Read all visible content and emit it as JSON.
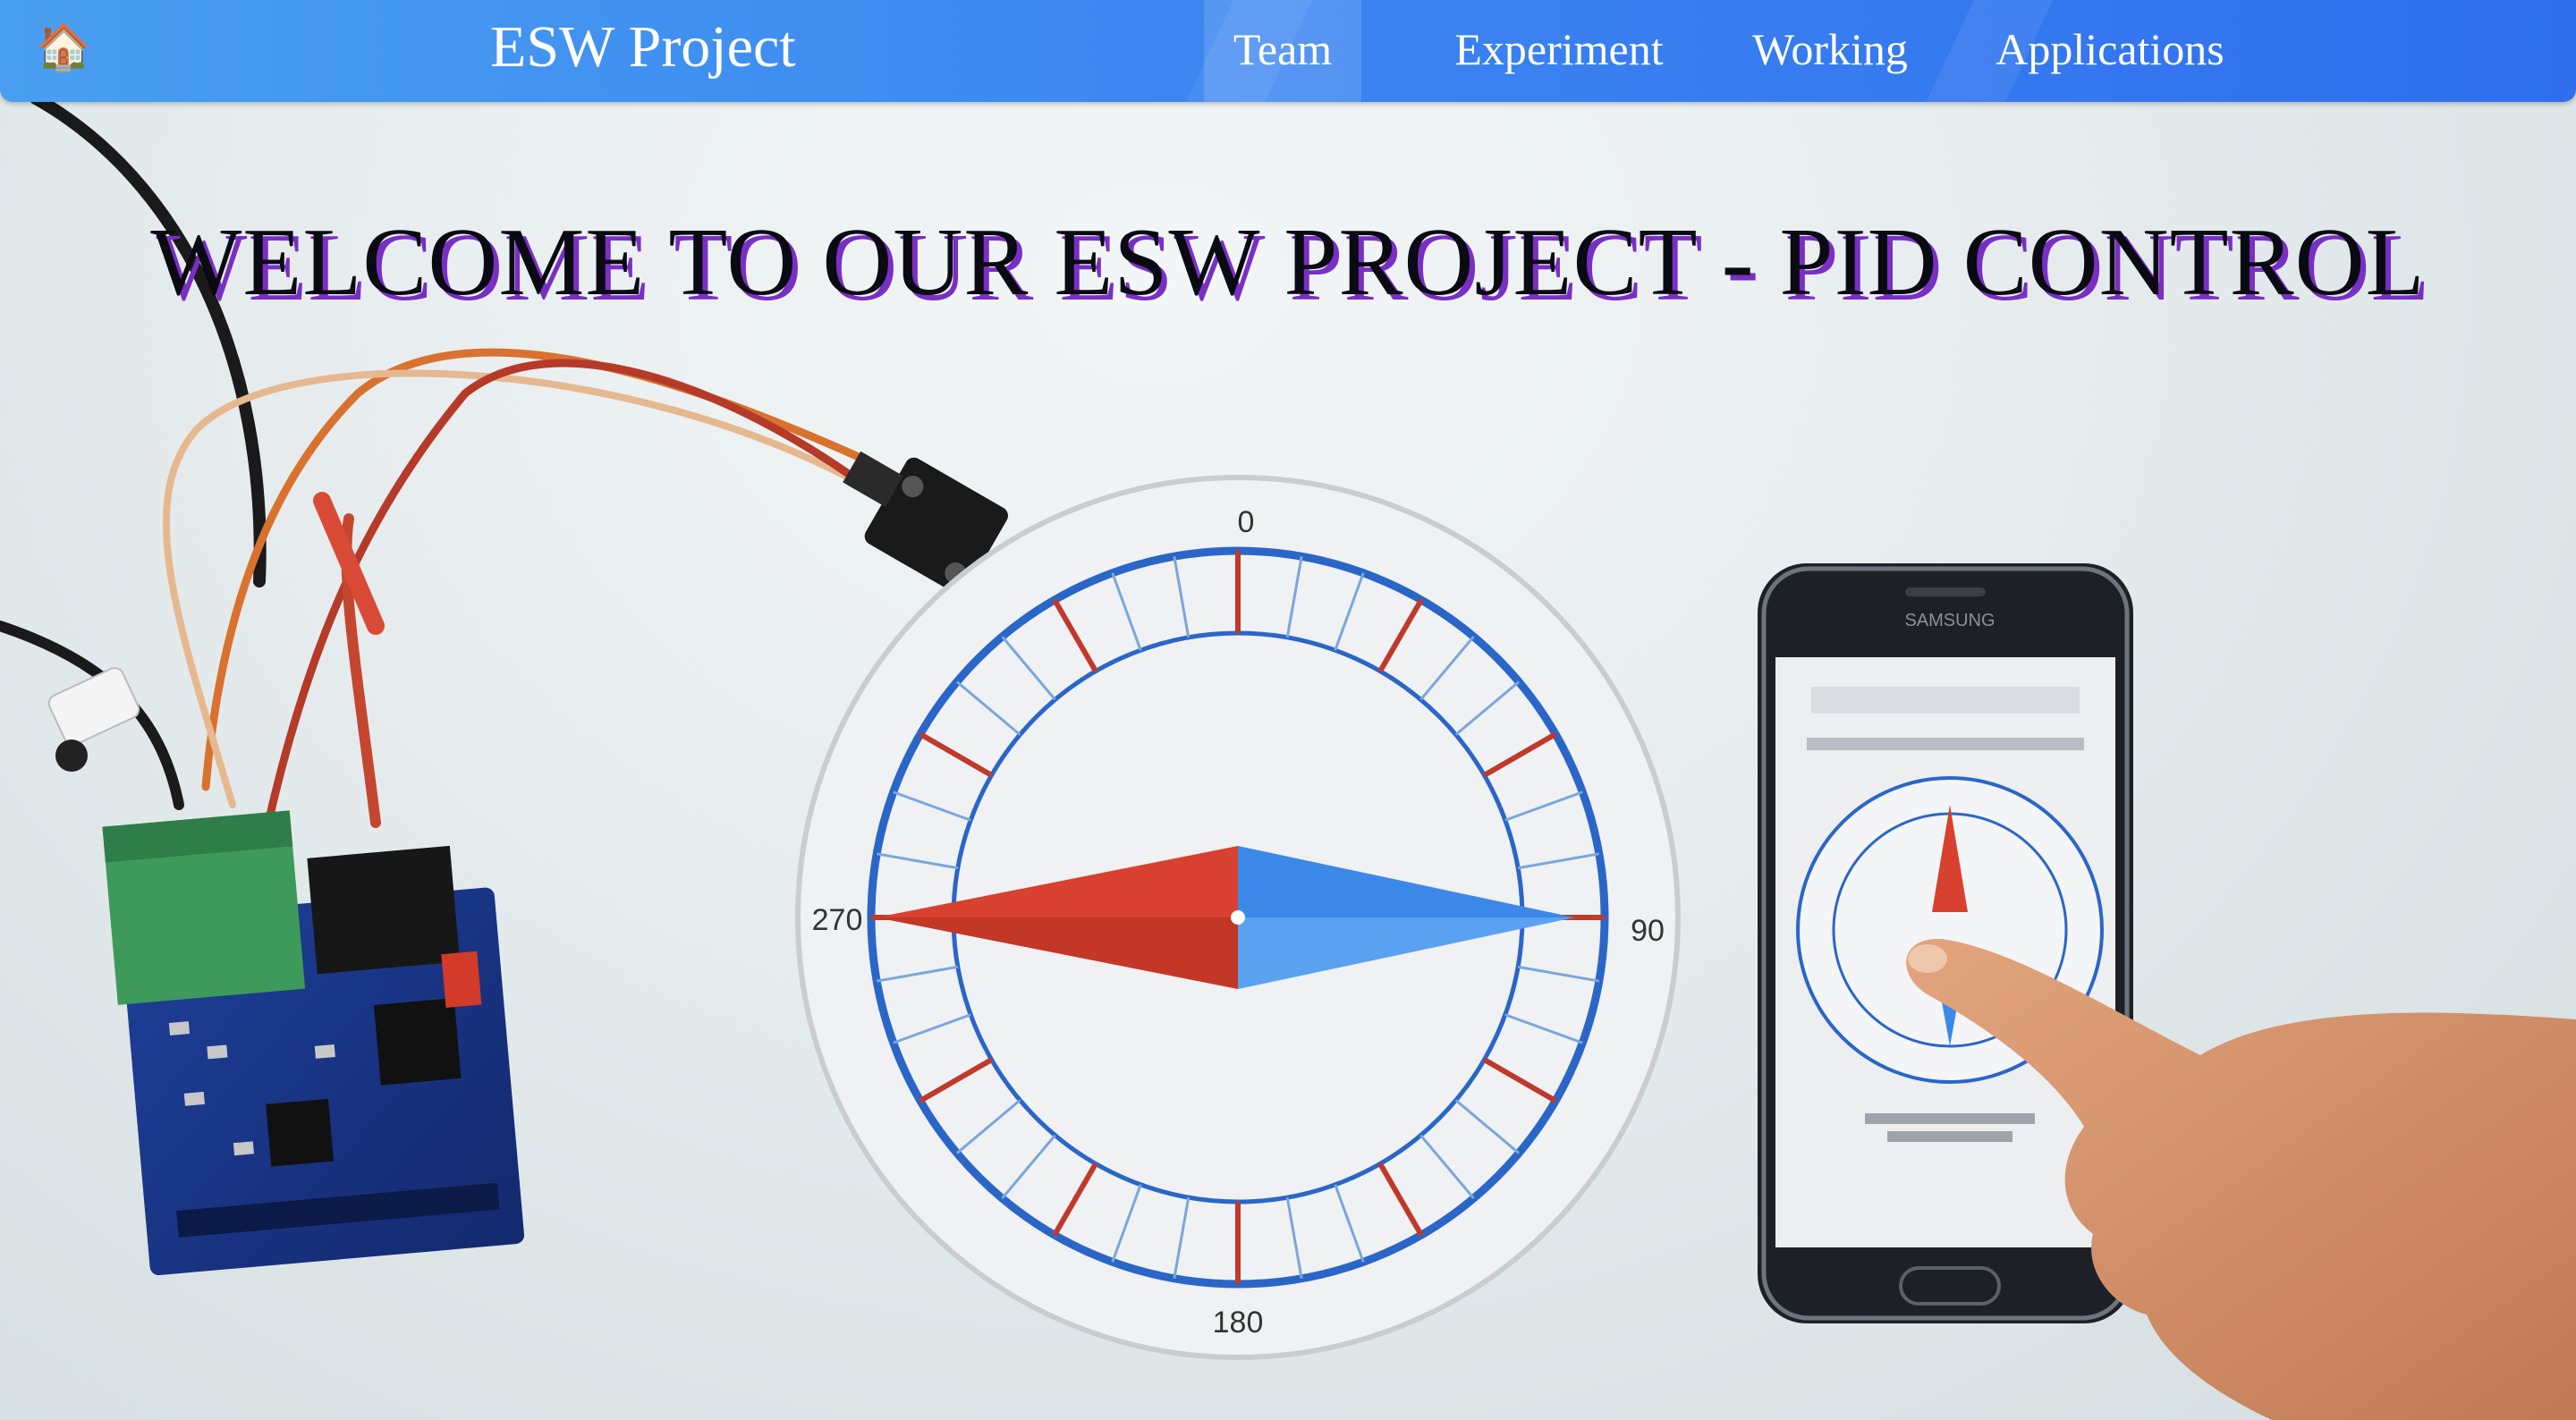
{
  "navbar": {
    "home_icon": "house-emoji-icon",
    "home_glyph": "🏠",
    "brand": "ESW Project",
    "links": [
      "Team",
      "Experiment",
      "Working",
      "Applications"
    ],
    "active_link": "Team",
    "colors": {
      "start": "#4a9ff0",
      "end": "#2f6fee",
      "text": "#ffffff"
    }
  },
  "hero": {
    "headline": "WELCOME TO OUR ESW PROJECT - PID CONTROL",
    "headline_shadow_color": "#7a2fc4",
    "image": {
      "compass_labels": {
        "north": "0",
        "east": "90",
        "south": "180",
        "west": "270"
      },
      "needle_colors": {
        "west": "#d8412f",
        "east": "#3b88e8"
      },
      "phone_brand": "SAMSUNG"
    }
  }
}
